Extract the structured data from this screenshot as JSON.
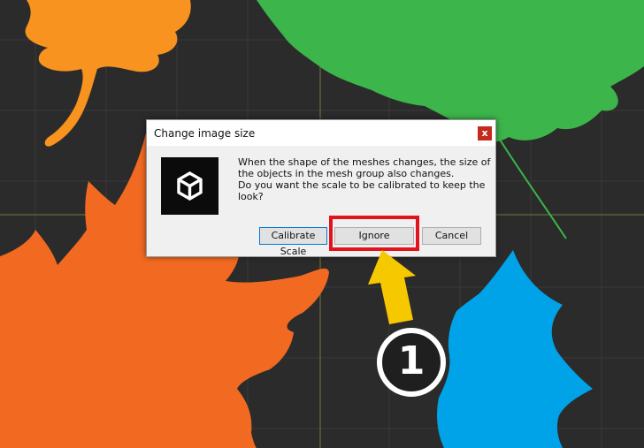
{
  "dialog": {
    "title": "Change image size",
    "close_label": "x",
    "message_lines": [
      "When the shape of the meshes changes, the size of",
      "the objects in the mesh group also changes.",
      "Do you want the scale to be calibrated to keep the",
      "look?"
    ],
    "buttons": {
      "calibrate": "Calibrate Scale",
      "ignore": "Ignore",
      "cancel": "Cancel"
    }
  },
  "annotation": {
    "step_number": "1",
    "highlight_color": "#e1141e",
    "arrow_color": "#f5c800"
  },
  "icons": {
    "app_logo": "unity-logo-icon"
  },
  "colors": {
    "background": "#2b2b2b",
    "leaf_orange_top": "#f7931e",
    "leaf_green": "#3cb54a",
    "leaf_orange_bottom": "#f26a22",
    "leaf_blue": "#00a3e8",
    "guide_line": "#7a7a3a"
  }
}
